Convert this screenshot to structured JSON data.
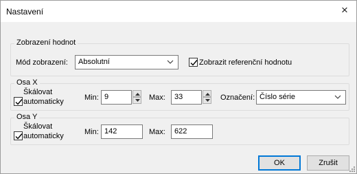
{
  "window": {
    "title": "Nastavení",
    "close_icon": "×"
  },
  "display": {
    "group_title": "Zobrazení hodnot",
    "mode_label": "Mód zobrazení:",
    "mode_value": "Absolutní",
    "show_reference_label": "Zobrazit referenční hodnotu",
    "show_reference_checked": true
  },
  "axis_x": {
    "group_title": "Osa X",
    "autoscale_label_line1": "Škálovat",
    "autoscale_label_line2": "automaticky",
    "autoscale_checked": true,
    "min_label": "Min:",
    "min_value": "9",
    "max_label": "Max:",
    "max_value": "33",
    "designation_label": "Označení:",
    "designation_value": "Číslo série"
  },
  "axis_y": {
    "group_title": "Osa Y",
    "autoscale_label_line1": "Škálovat",
    "autoscale_label_line2": "automaticky",
    "autoscale_checked": true,
    "min_label": "Min:",
    "min_value": "142",
    "max_label": "Max:",
    "max_value": "622"
  },
  "buttons": {
    "ok": "OK",
    "cancel": "Zrušit"
  }
}
